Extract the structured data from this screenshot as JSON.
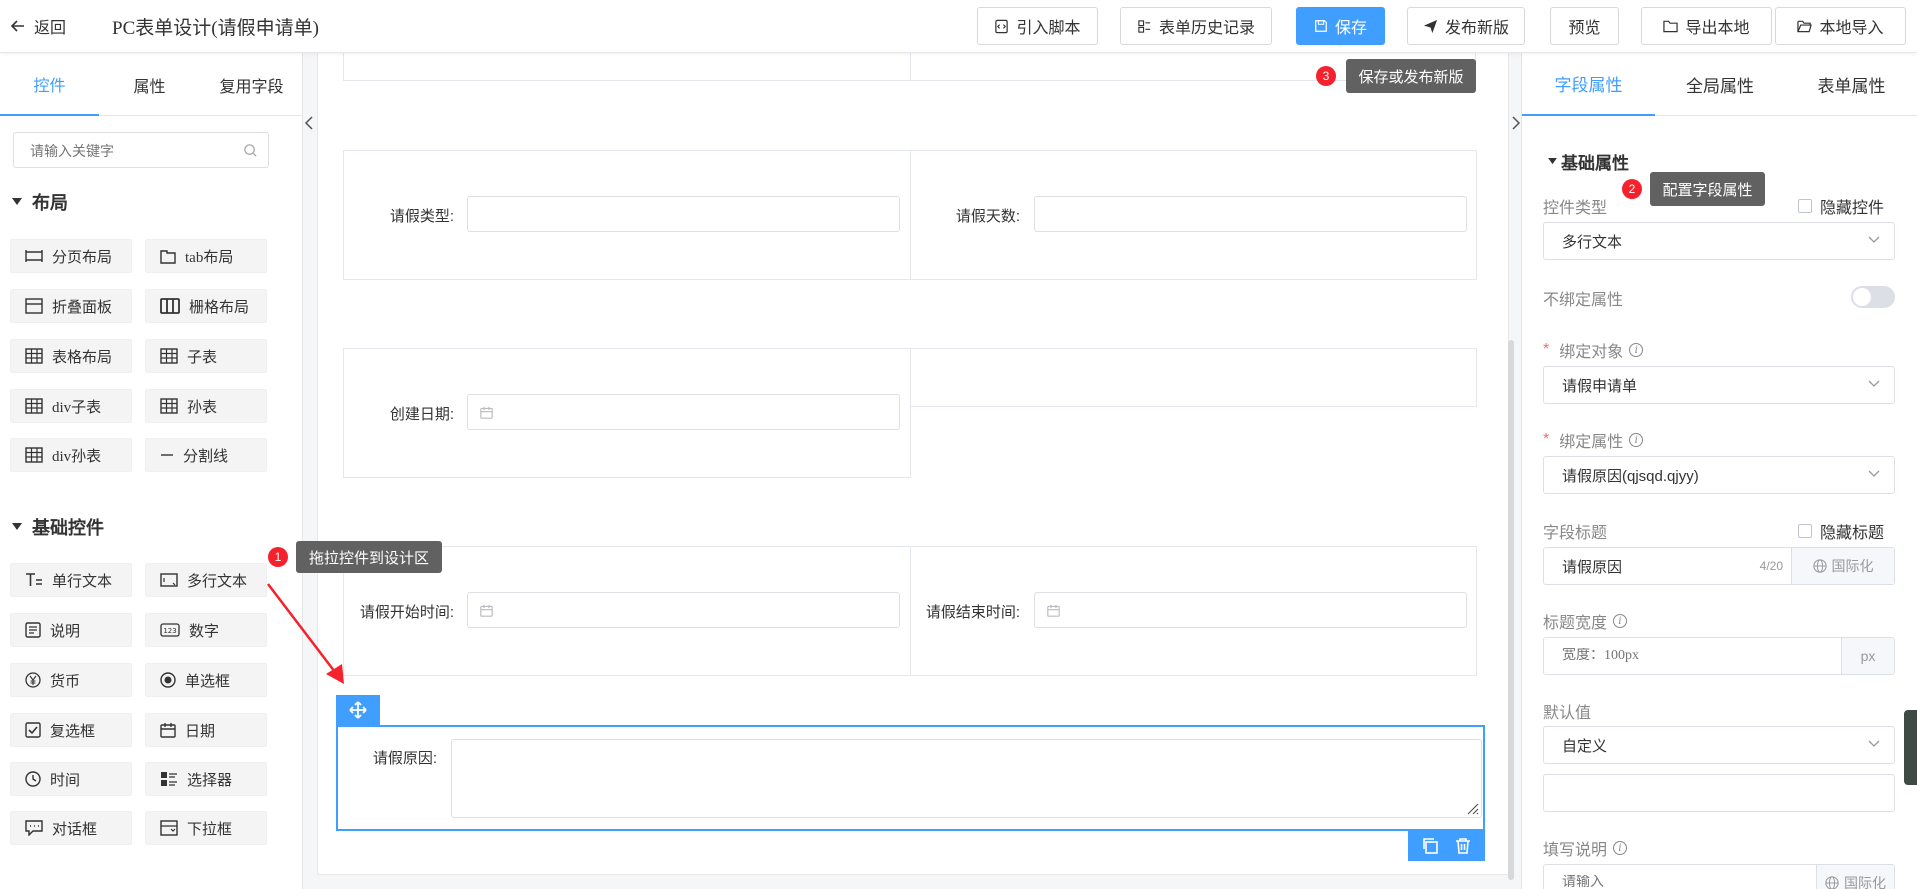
{
  "header": {
    "back_label": "返回",
    "title": "PC表单设计(请假申请单)",
    "buttons": {
      "import_script": "引入脚本",
      "history": "表单历史记录",
      "save": "保存",
      "publish": "发布新版",
      "preview": "预览",
      "export_local": "导出本地",
      "import_local": "本地导入"
    }
  },
  "left_panel": {
    "tabs": [
      "控件",
      "属性",
      "复用字段"
    ],
    "search_placeholder": "请输入关键字",
    "layout_section": {
      "title": "布局",
      "items": [
        "分页布局",
        "tab布局",
        "折叠面板",
        "栅格布局",
        "表格布局",
        "子表",
        "div子表",
        "孙表",
        "div孙表",
        "分割线"
      ]
    },
    "basic_section": {
      "title": "基础控件",
      "items": [
        "单行文本",
        "多行文本",
        "说明",
        "数字",
        "货币",
        "单选框",
        "复选框",
        "日期",
        "时间",
        "选择器",
        "对话框",
        "下拉框"
      ]
    }
  },
  "canvas": {
    "fields": {
      "leave_type": "请假类型:",
      "leave_days": "请假天数:",
      "create_date": "创建日期:",
      "start_time": "请假开始时间:",
      "end_time": "请假结束时间:",
      "reason": "请假原因:"
    }
  },
  "right_panel": {
    "tabs": [
      "字段属性",
      "全局属性",
      "表单属性"
    ],
    "section_title": "基础属性",
    "control_type": {
      "label": "控件类型",
      "value": "多行文本",
      "hide_label": "隐藏控件"
    },
    "unbind": {
      "label": "不绑定属性"
    },
    "bind_object": {
      "label": "绑定对象",
      "value": "请假申请单"
    },
    "bind_attr": {
      "label": "绑定属性",
      "value": "请假原因(qjsqd.qjyy)"
    },
    "field_title": {
      "label": "字段标题",
      "value": "请假原因",
      "counter": "4/20",
      "i18n": "国际化",
      "hide_label": "隐藏标题"
    },
    "title_width": {
      "label": "标题宽度",
      "placeholder": "宽度：100px",
      "unit": "px"
    },
    "default_value": {
      "label": "默认值",
      "value": "自定义"
    },
    "fill_desc": {
      "label": "填写说明",
      "placeholder": "请输入",
      "i18n": "国际化"
    }
  },
  "guides": {
    "step1": {
      "num": "1",
      "text": "拖拉控件到设计区"
    },
    "step2": {
      "num": "2",
      "text": "配置字段属性"
    },
    "step3": {
      "num": "3",
      "text": "保存或发布新版"
    }
  },
  "colors": {
    "primary": "#409eff",
    "badge": "#f5222d",
    "tooltip": "#616161",
    "arrow": "#f5222d"
  }
}
